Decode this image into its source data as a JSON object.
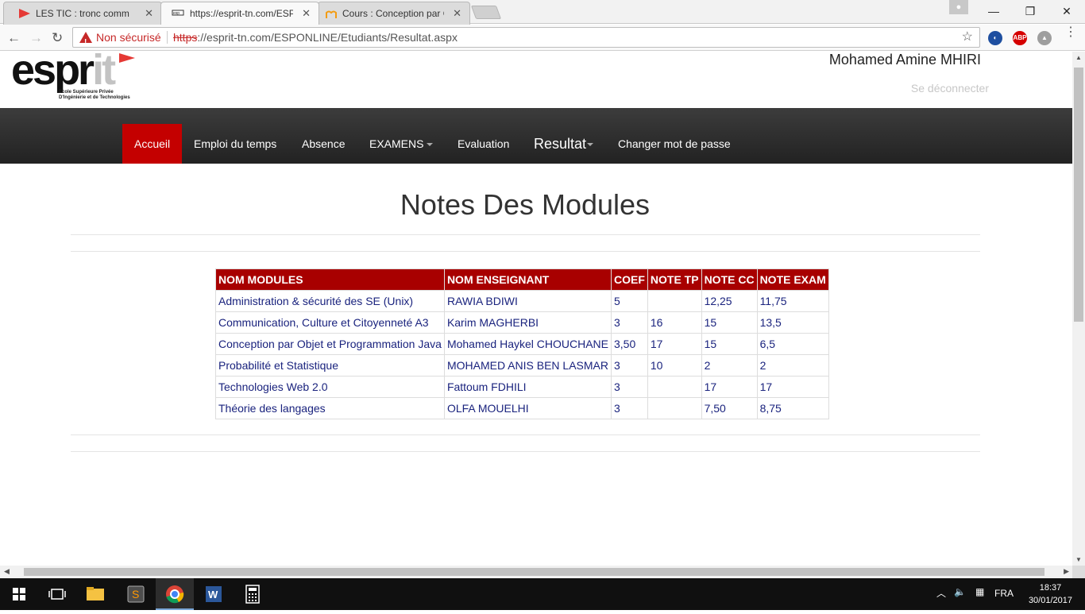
{
  "browser": {
    "tabs": [
      {
        "label": "LES TIC : tronc commun",
        "icon": "play-icon"
      },
      {
        "label": "https://esprit-tn.com/ESP",
        "icon": "esprit-favicon"
      },
      {
        "label": "Cours : Conception par O",
        "icon": "moodle-favicon"
      }
    ],
    "security_label": "Non sécurisé",
    "url_protocol": "https",
    "url_rest": "://esprit-tn.com/ESPONLINE/Etudiants/Resultat.aspx",
    "extensions": [
      "ABP"
    ]
  },
  "site": {
    "logo_text": "espr",
    "logo_it": "it",
    "logo_subtitle_1": "Ecole Supérieure Privée",
    "logo_subtitle_2": "D'Ingénierie et de Technologies",
    "username": "Mohamed Amine MHIRI",
    "logout_label": "Se déconnecter"
  },
  "nav": {
    "accueil": "Accueil",
    "emploi": "Emploi du temps",
    "absence": "Absence",
    "examens": "EXAMENS",
    "evaluation": "Evaluation",
    "resultat": "Resultat",
    "changer": "Changer mot de passe"
  },
  "page": {
    "title": "Notes Des Modules"
  },
  "table": {
    "headers": [
      "NOM MODULES",
      "NOM ENSEIGNANT",
      "COEF",
      "NOTE TP",
      "NOTE CC",
      "NOTE EXAM"
    ],
    "rows": [
      [
        "Administration & sécurité des SE (Unix)",
        "RAWIA BDIWI",
        "5",
        "",
        "12,25",
        "11,75"
      ],
      [
        "Communication, Culture et Citoyenneté A3",
        "Karim MAGHERBI",
        "3",
        "16",
        "15",
        "13,5"
      ],
      [
        "Conception par Objet et Programmation Java",
        "Mohamed Haykel CHOUCHANE",
        "3,50",
        "17",
        "15",
        "6,5"
      ],
      [
        "Probabilité et Statistique",
        "MOHAMED ANIS BEN LASMAR",
        "3",
        "10",
        "2",
        "2"
      ],
      [
        "Technologies Web 2.0",
        "Fattoum FDHILI",
        "3",
        "",
        "17",
        "17"
      ],
      [
        "Théorie des langages",
        "OLFA MOUELHI",
        "3",
        "",
        "7,50",
        "8,75"
      ]
    ]
  },
  "taskbar": {
    "language": "FRA",
    "time": "18:37",
    "date": "30/01/2017"
  },
  "colors": {
    "brand_red": "#c40000",
    "table_header": "#a80000",
    "navbar_dark": "#2a2a2a"
  }
}
